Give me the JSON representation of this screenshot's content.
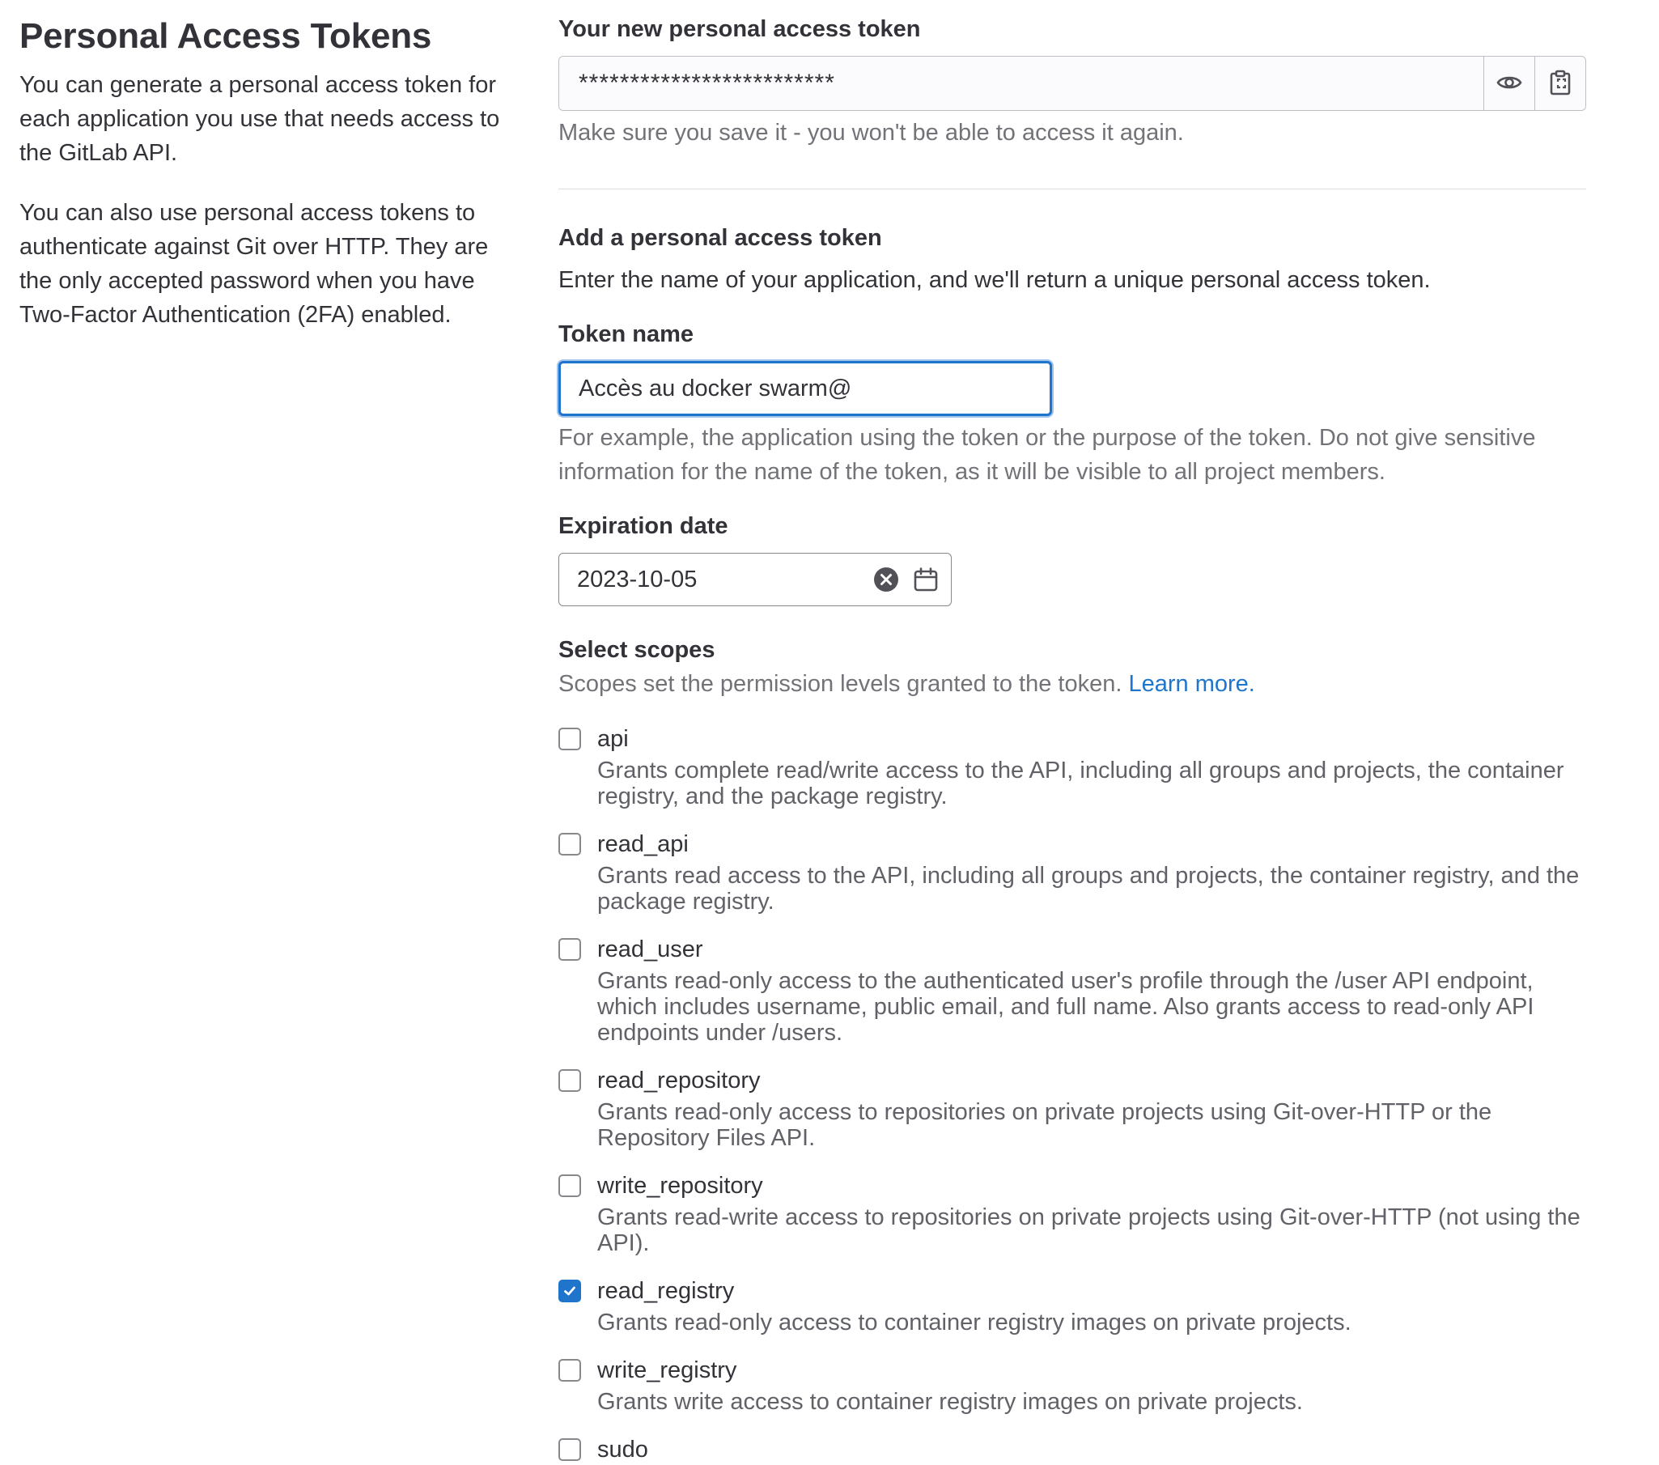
{
  "sidebar": {
    "title": "Personal Access Tokens",
    "paragraph1": "You can generate a personal access token for each application you use that needs access to the GitLab API.",
    "paragraph2": "You can also use personal access tokens to authenticate against Git over HTTP. They are the only accepted password when you have Two-Factor Authentication (2FA) enabled."
  },
  "new_token": {
    "label": "Your new personal access token",
    "value": "*************************",
    "help": "Make sure you save it - you won't be able to access it again.",
    "reveal_icon": "eye-icon",
    "copy_icon": "clipboard-icon"
  },
  "add_token": {
    "title": "Add a personal access token",
    "description": "Enter the name of your application, and we'll return a unique personal access token.",
    "name_label": "Token name",
    "name_value": "Accès au docker swarm@",
    "name_help": "For example, the application using the token or the purpose of the token. Do not give sensitive information for the name of the token, as it will be visible to all project members.",
    "expiration_label": "Expiration date",
    "expiration_value": "2023-10-05",
    "scopes_label": "Select scopes",
    "scopes_help": "Scopes set the permission levels granted to the token.",
    "learn_more": "Learn more."
  },
  "scopes": [
    {
      "name": "api",
      "checked": false,
      "description": "Grants complete read/write access to the API, including all groups and projects, the container registry, and the package registry."
    },
    {
      "name": "read_api",
      "checked": false,
      "description": "Grants read access to the API, including all groups and projects, the container registry, and the package registry."
    },
    {
      "name": "read_user",
      "checked": false,
      "description": "Grants read-only access to the authenticated user's profile through the /user API endpoint, which includes username, public email, and full name. Also grants access to read-only API endpoints under /users."
    },
    {
      "name": "read_repository",
      "checked": false,
      "description": "Grants read-only access to repositories on private projects using Git-over-HTTP or the Repository Files API."
    },
    {
      "name": "write_repository",
      "checked": false,
      "description": "Grants read-write access to repositories on private projects using Git-over-HTTP (not using the API)."
    },
    {
      "name": "read_registry",
      "checked": true,
      "description": "Grants read-only access to container registry images on private projects."
    },
    {
      "name": "write_registry",
      "checked": false,
      "description": "Grants write access to container registry images on private projects."
    },
    {
      "name": "sudo",
      "checked": false,
      "description": ""
    }
  ],
  "colors": {
    "accent": "#1f75cb",
    "text": "#333238",
    "muted": "#737278"
  }
}
